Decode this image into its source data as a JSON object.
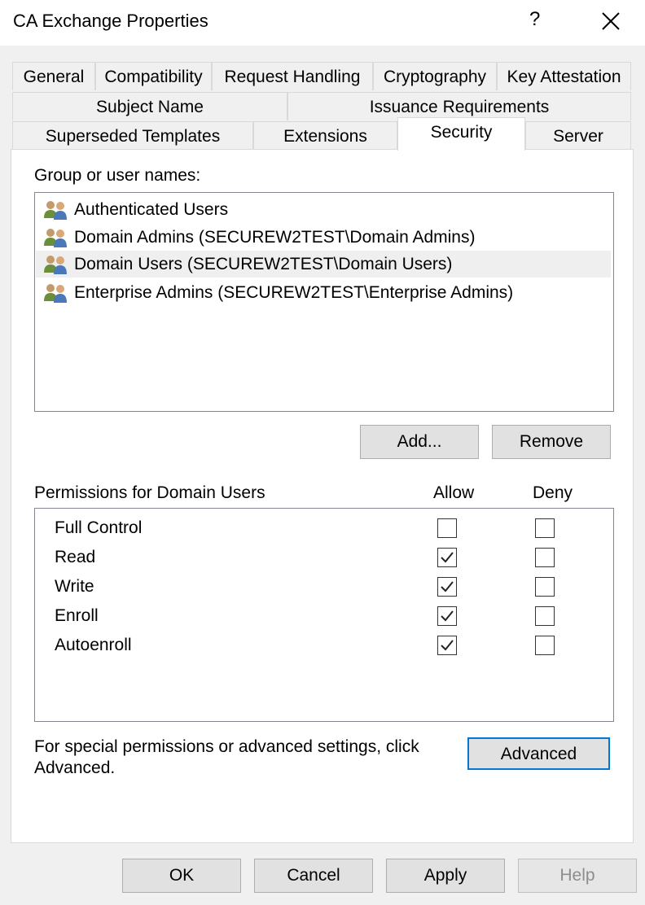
{
  "window": {
    "title": "CA Exchange Properties",
    "help_glyph": "?",
    "close_icon": "close-icon"
  },
  "tabs": {
    "row1": [
      "General",
      "Compatibility",
      "Request Handling",
      "Cryptography",
      "Key Attestation"
    ],
    "row2": [
      "Subject Name",
      "Issuance Requirements"
    ],
    "row3": [
      "Superseded Templates",
      "Extensions",
      "Security",
      "Server"
    ],
    "active": "Security"
  },
  "security": {
    "group_label": "Group or user names:",
    "users": [
      {
        "name": "Authenticated Users",
        "icon": "users-icon",
        "selected": false
      },
      {
        "name": "Domain Admins (SECUREW2TEST\\Domain Admins)",
        "icon": "users-icon",
        "selected": false
      },
      {
        "name": "Domain Users (SECUREW2TEST\\Domain Users)",
        "icon": "users-icon",
        "selected": true
      },
      {
        "name": "Enterprise Admins (SECUREW2TEST\\Enterprise Admins)",
        "icon": "users-icon",
        "selected": false
      }
    ],
    "add_label": "Add...",
    "remove_label": "Remove",
    "permissions_label": "Permissions for Domain Users",
    "allow_header": "Allow",
    "deny_header": "Deny",
    "permissions": [
      {
        "name": "Full Control",
        "allow": false,
        "deny": false
      },
      {
        "name": "Read",
        "allow": true,
        "deny": false
      },
      {
        "name": "Write",
        "allow": true,
        "deny": false
      },
      {
        "name": "Enroll",
        "allow": true,
        "deny": false
      },
      {
        "name": "Autoenroll",
        "allow": true,
        "deny": false
      }
    ],
    "advanced_note": "For special permissions or advanced settings, click Advanced.",
    "advanced_label": "Advanced"
  },
  "footer": {
    "ok_label": "OK",
    "cancel_label": "Cancel",
    "apply_label": "Apply",
    "help_label": "Help"
  },
  "colors": {
    "focus_border": "#0078d7",
    "selected_row": "#efefef",
    "dialog_bg": "#f0f0f0"
  }
}
